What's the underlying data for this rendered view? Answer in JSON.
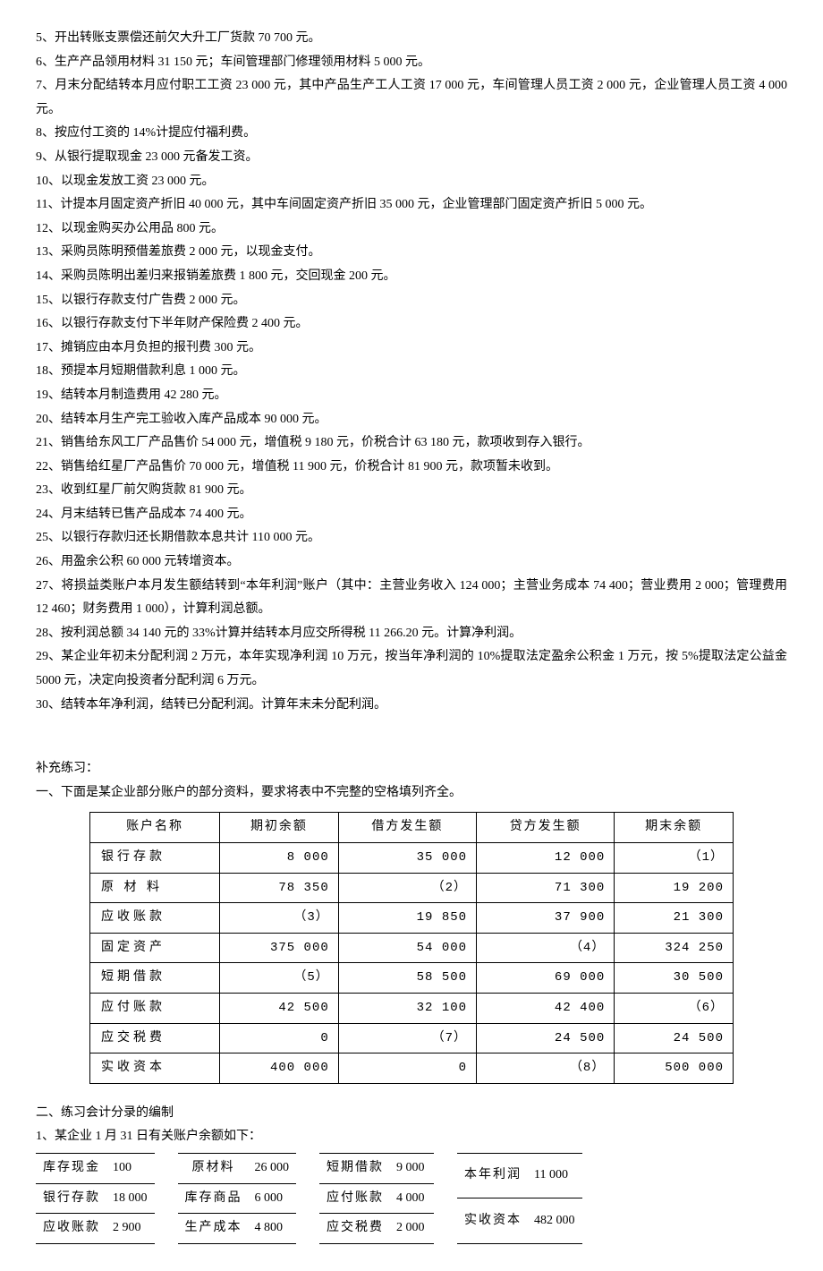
{
  "items": [
    "5、开出转账支票偿还前欠大升工厂货款 70 700 元。",
    "6、生产产品领用材料 31 150 元；车间管理部门修理领用材料 5 000 元。",
    "7、月末分配结转本月应付职工工资 23 000 元，其中产品生产工人工资 17 000 元，车间管理人员工资 2 000 元，企业管理人员工资 4 000 元。",
    "8、按应付工资的 14%计提应付福利费。",
    "9、从银行提取现金 23 000 元备发工资。",
    "10、以现金发放工资 23 000 元。",
    "11、计提本月固定资产折旧 40 000 元，其中车间固定资产折旧 35 000 元，企业管理部门固定资产折旧 5 000 元。",
    "12、以现金购买办公用品 800 元。",
    "13、采购员陈明预借差旅费 2 000 元，以现金支付。",
    "14、采购员陈明出差归来报销差旅费 1 800 元，交回现金 200 元。",
    "15、以银行存款支付广告费 2 000 元。",
    "16、以银行存款支付下半年财产保险费 2 400 元。",
    "17、摊销应由本月负担的报刊费 300 元。",
    "18、预提本月短期借款利息 1 000 元。",
    "19、结转本月制造费用 42 280 元。",
    "20、结转本月生产完工验收入库产品成本 90 000 元。",
    "21、销售给东风工厂产品售价 54 000 元，增值税 9 180 元，价税合计 63 180 元，款项收到存入银行。",
    "22、销售给红星厂产品售价 70 000 元，增值税 11 900 元，价税合计 81 900 元，款项暂未收到。",
    "23、收到红星厂前欠购货款 81 900 元。",
    "24、月末结转已售产品成本 74 400 元。",
    "25、以银行存款归还长期借款本息共计 110 000 元。",
    "26、用盈余公积 60 000 元转增资本。",
    "27、将损益类账户本月发生额结转到“本年利润”账户（其中：主营业务收入 124 000；主营业务成本 74 400；营业费用 2 000；管理费用 12 460；财务费用 1 000），计算利润总额。",
    "28、按利润总额 34 140 元的 33%计算并结转本月应交所得税 11 266.20 元。计算净利润。",
    "29、某企业年初未分配利润 2 万元，本年实现净利润 10 万元，按当年净利润的 10%提取法定盈余公积金 1 万元，按 5%提取法定公益金 5000 元，决定向投资者分配利润 6 万元。",
    "30、结转本年净利润，结转已分配利润。计算年末未分配利润。"
  ],
  "supp_title": "补充练习：",
  "supp_one": "一、下面是某企业部分账户的部分资料，要求将表中不完整的空格填列齐全。",
  "table_headers": [
    "账户名称",
    "期初余额",
    "借方发生额",
    "贷方发生额",
    "期末余额"
  ],
  "table_rows": [
    {
      "name": "银行存款",
      "c1": "8 000",
      "c2": "35 000",
      "c3": "12 000",
      "c4": "（1）"
    },
    {
      "name": "原 材 料",
      "c1": "78 350",
      "c2": "（2）",
      "c3": "71 300",
      "c4": "19 200"
    },
    {
      "name": "应收账款",
      "c1": "（3）",
      "c2": "19 850",
      "c3": "37 900",
      "c4": "21 300"
    },
    {
      "name": "固定资产",
      "c1": "375 000",
      "c2": "54 000",
      "c3": "（4）",
      "c4": "324 250"
    },
    {
      "name": "短期借款",
      "c1": "（5）",
      "c2": "58 500",
      "c3": "69 000",
      "c4": "30 500"
    },
    {
      "name": "应付账款",
      "c1": "42 500",
      "c2": "32 100",
      "c3": "42 400",
      "c4": "（6）"
    },
    {
      "name": "应交税费",
      "c1": "0",
      "c2": "（7）",
      "c3": "24 500",
      "c4": "24 500"
    },
    {
      "name": "实收资本",
      "c1": "400 000",
      "c2": "0",
      "c3": "（8）",
      "c4": "500 000"
    }
  ],
  "supp_two": "二、练习会计分录的编制",
  "supp_two_1": "1、某企业 1 月 31 日有关账户余额如下：",
  "bal_cols": [
    [
      {
        "n": "库存现金",
        "v": "100"
      },
      {
        "n": "银行存款",
        "v": "18 000"
      },
      {
        "n": "应收账款",
        "v": "2 900"
      }
    ],
    [
      {
        "n": "原材料",
        "v": "26 000"
      },
      {
        "n": "库存商品",
        "v": "6 000"
      },
      {
        "n": "生产成本",
        "v": "4 800"
      }
    ],
    [
      {
        "n": "短期借款",
        "v": "9 000"
      },
      {
        "n": "应付账款",
        "v": "4 000"
      },
      {
        "n": "应交税费",
        "v": "2 000"
      }
    ],
    [
      {
        "n": "本年利润",
        "v": "11 000"
      },
      {
        "n": "实收资本",
        "v": "482 000"
      }
    ]
  ]
}
